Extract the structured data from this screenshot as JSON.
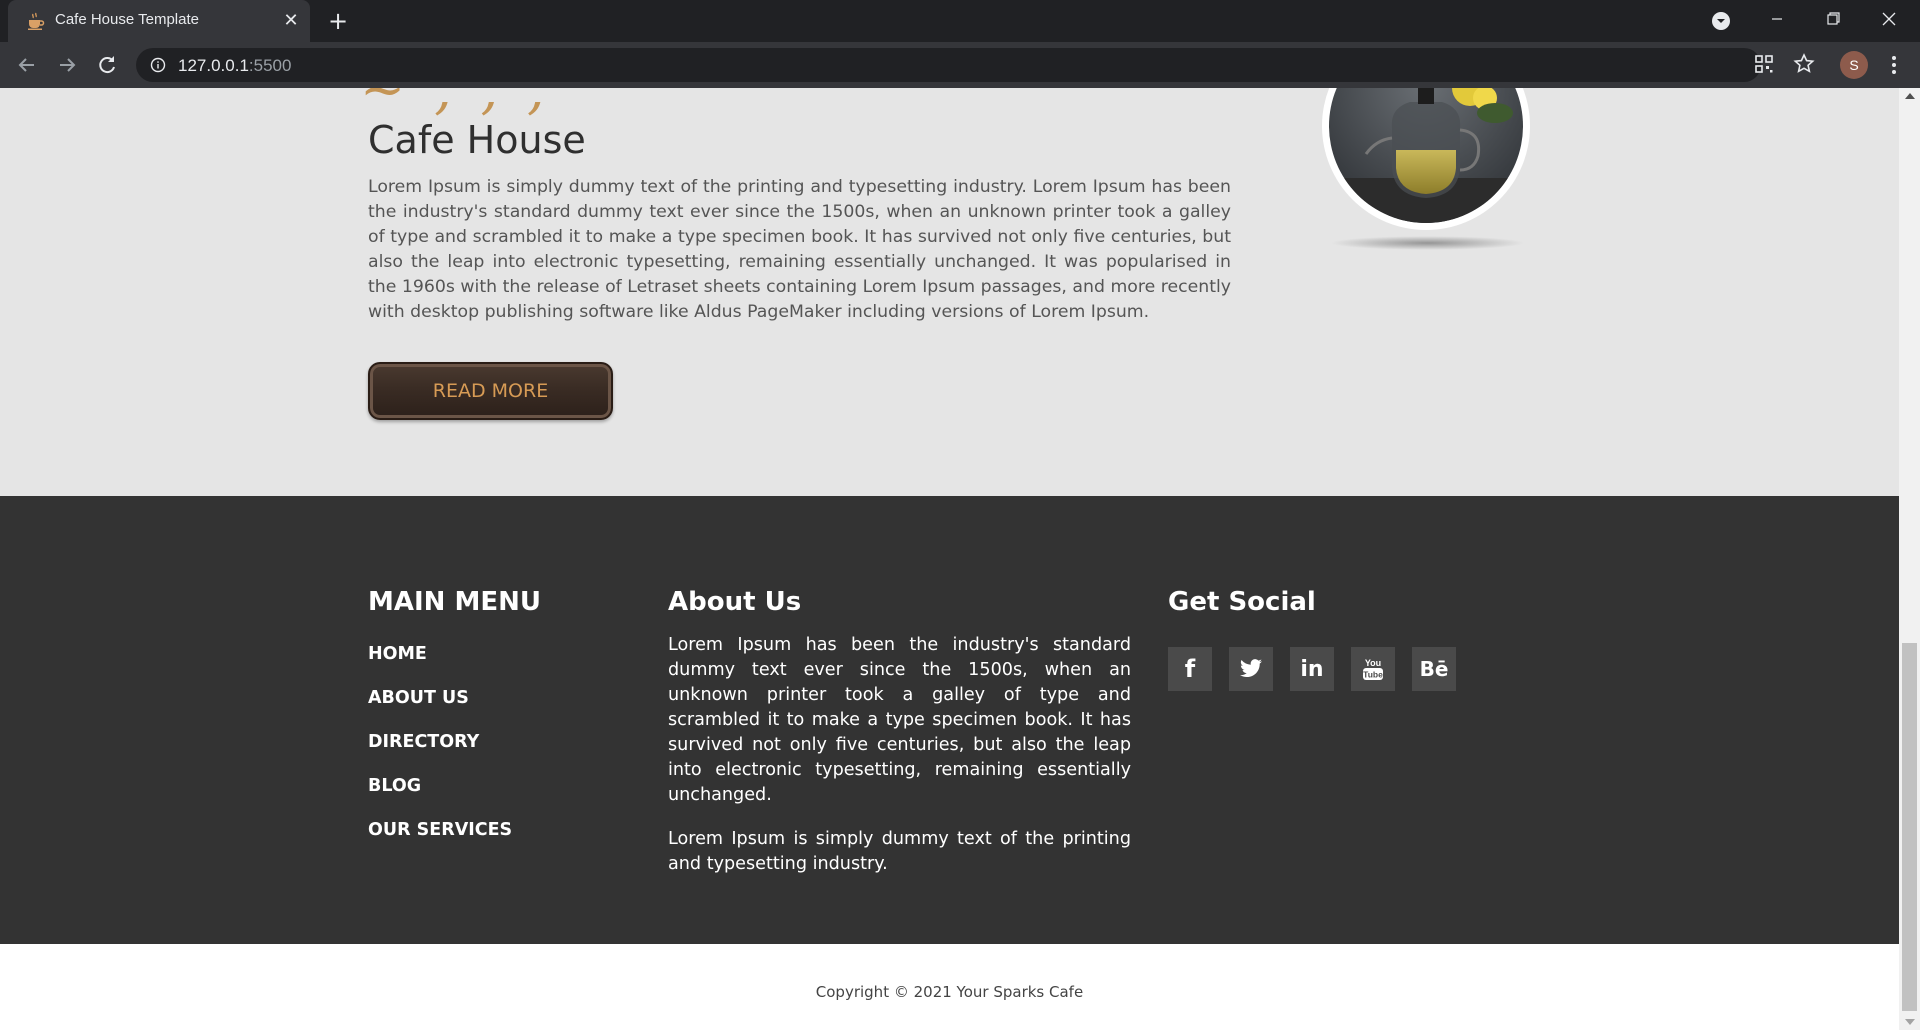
{
  "browser": {
    "tab_title": "Cafe House Template",
    "url_host": "127.0.0.1",
    "url_port": ":5500",
    "avatar_letter": "S"
  },
  "about": {
    "title": "Cafe House",
    "text": "Lorem Ipsum is simply dummy text of the printing and typesetting industry. Lorem Ipsum has been the industry's standard dummy text ever since the 1500s, when an unknown printer took a galley of type and scrambled it to make a type specimen book. It has survived not only five centuries, but also the leap into electronic typesetting, remaining essentially unchanged. It was popularised in the 1960s with the release of Letraset sheets containing Lorem Ipsum passages, and more recently with desktop publishing software like Aldus PageMaker including versions of Lorem Ipsum.",
    "button_label": "READ MORE"
  },
  "footer": {
    "main_menu": {
      "heading": "MAIN MENU",
      "items": [
        "HOME",
        "ABOUT US",
        "DIRECTORY",
        "BLOG",
        "OUR SERVICES"
      ]
    },
    "about_us": {
      "heading": "About Us",
      "paragraphs": [
        "Lorem Ipsum has been the industry's standard dummy text ever since the 1500s, when an unknown printer took a galley of type and scrambled it to make a type specimen book. It has survived not only five centuries, but also the leap into electronic typesetting, remaining essentially unchanged.",
        "Lorem Ipsum is simply dummy text of the printing and typesetting industry."
      ]
    },
    "social": {
      "heading": "Get Social",
      "icons": [
        "facebook-icon",
        "twitter-icon",
        "linkedin-icon",
        "youtube-icon",
        "behance-icon"
      ],
      "glyphs": [
        "f",
        "",
        "in",
        "",
        "Bē"
      ]
    },
    "copyright": "Copyright © 2021 Your Sparks Cafe"
  },
  "colors": {
    "accent": "#c49556",
    "footer_bg": "#333333",
    "section_bg": "#e5e5e5"
  }
}
